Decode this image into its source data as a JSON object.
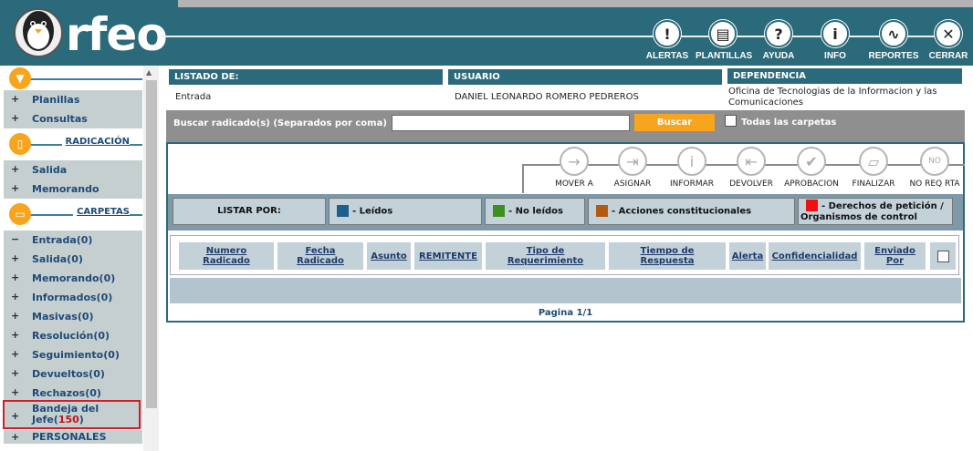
{
  "brand": {
    "name": "rfeo"
  },
  "header": {
    "buttons": [
      {
        "label": "ALERTAS",
        "icon": "alert-icon"
      },
      {
        "label": "PLANTILLAS",
        "icon": "templates-icon"
      },
      {
        "label": "AYUDA",
        "icon": "help-icon"
      },
      {
        "label": "INFO",
        "icon": "info-icon"
      },
      {
        "label": "REPORTES",
        "icon": "reports-icon"
      },
      {
        "label": "CERRAR",
        "icon": "close-icon"
      }
    ]
  },
  "sidebar": {
    "top_items": [
      "Planillas",
      "Consultas"
    ],
    "radicacion_title": "RADICACIÓN",
    "radicacion_items": [
      "Salida",
      "Memorando"
    ],
    "carpetas_title": "CARPETAS",
    "carpetas_items": [
      "Entrada(0)",
      "Salida(0)",
      "Memorando(0)",
      "Informados(0)",
      "Masivas(0)",
      "Resolución(0)",
      "Seguimiento(0)",
      "Devueltos(0)",
      "Rechazos(0)"
    ],
    "bandeja": {
      "line1": "Bandeja del",
      "line2": "Jefe(",
      "count": "150",
      "close": ")"
    },
    "personales": "PERSONALES"
  },
  "info": {
    "listado_header": "LISTADO DE:",
    "listado_value": "Entrada",
    "usuario_header": "USUARIO",
    "usuario_value": "DANIEL LEONARDO ROMERO PEDREROS",
    "dependencia_header": "DEPENDENCIA",
    "dependencia_value": "Oficina de Tecnologias de la Informacion y las Comunicaciones"
  },
  "search": {
    "label": "Buscar radicado(s) (Separados por coma)",
    "value": "",
    "button": "Buscar",
    "all_folders": "Todas las carpetas"
  },
  "actions": [
    "MOVER A",
    "ASIGNAR",
    "INFORMAR",
    "DEVOLVER",
    "APROBACION",
    "FINALIZAR",
    "NO REQ RTA"
  ],
  "listar": {
    "label": "LISTAR POR:",
    "legend": [
      {
        "text": "- Leídos",
        "color": "#1f5f8b"
      },
      {
        "text": "- No leídos",
        "color": "#3d8f1f"
      },
      {
        "text": "- Acciones constitucionales",
        "color": "#b35a10"
      },
      {
        "text": "- Derechos de petición /",
        "text2": "Organismos de control",
        "color": "#ee1111"
      }
    ]
  },
  "columns": [
    {
      "l1": "Numero",
      "l2": "Radicado"
    },
    {
      "l1": "Fecha",
      "l2": "Radicado"
    },
    {
      "l1": "Asunto",
      "l2": ""
    },
    {
      "l1": "REMITENTE",
      "l2": ""
    },
    {
      "l1": "Tipo de",
      "l2": "Requerimiento"
    },
    {
      "l1": "Tiempo de",
      "l2": "Respuesta"
    },
    {
      "l1": "Alerta",
      "l2": ""
    },
    {
      "l1": "Confidencialidad",
      "l2": ""
    },
    {
      "l1": "Enviado",
      "l2": "Por"
    }
  ],
  "pager": "Pagina 1/1",
  "colors": {
    "header": "#2b6a7a",
    "accent": "#f8a41c",
    "sidebar_item": "#c6cfcf"
  }
}
